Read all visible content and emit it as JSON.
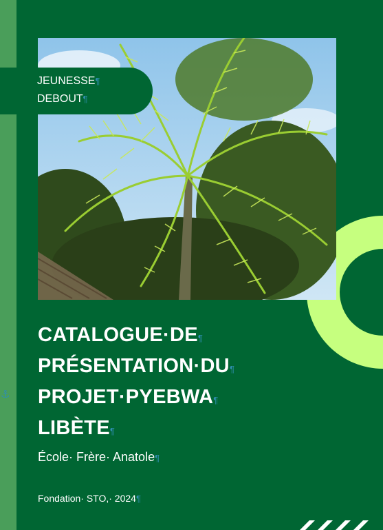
{
  "cover": {
    "tag_line1": "JEUNESSE",
    "tag_line2": "DEBOUT",
    "title_line1": "CATALOGUE·DE",
    "title_line2": "PRÉSENTATION·DU",
    "title_line3": "PROJET·PYEBWA",
    "title_line4": "LIBÈTE",
    "subtitle": "École· Frère· Anatole",
    "footer": "Fondation· STO,· 2024",
    "pilcrow": "¶",
    "anchor_icon": "⚓"
  },
  "colors": {
    "background": "#006633",
    "left_band": "#4a9e5a",
    "accent": "#c6ff7f",
    "text": "#ffffff",
    "formatting_marks": "#2f8fb0"
  },
  "icons": {
    "anchor": "anchor-icon",
    "chevrons": "chevron-right-icon"
  }
}
